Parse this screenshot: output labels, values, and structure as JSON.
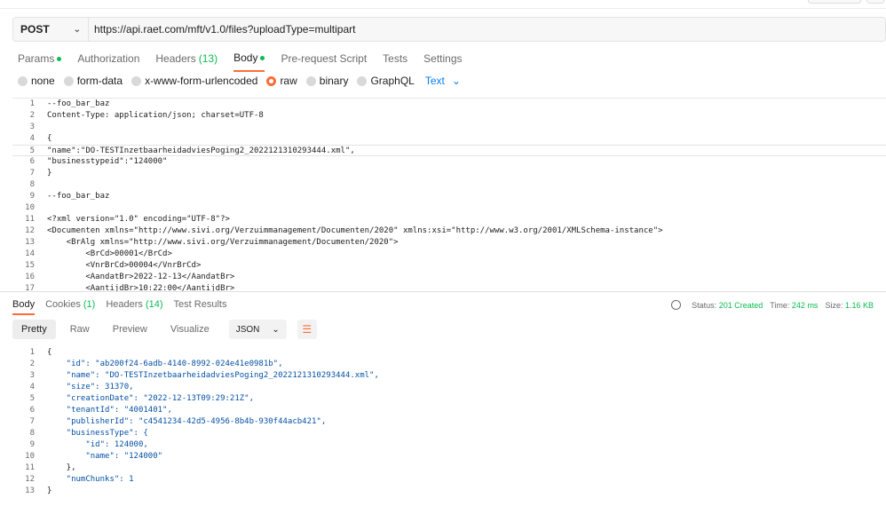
{
  "request": {
    "method": "POST",
    "url": "https://api.raet.com/mft/v1.0/files?uploadType=multipart"
  },
  "tabs": [
    {
      "label": "Params",
      "dot": true
    },
    {
      "label": "Authorization"
    },
    {
      "label": "Headers",
      "count": "(13)"
    },
    {
      "label": "Body",
      "dot": true,
      "active": true
    },
    {
      "label": "Pre-request Script"
    },
    {
      "label": "Tests"
    },
    {
      "label": "Settings"
    }
  ],
  "body_types": [
    {
      "label": "none"
    },
    {
      "label": "form-data"
    },
    {
      "label": "x-www-form-urlencoded"
    },
    {
      "label": "raw",
      "selected": true
    },
    {
      "label": "binary"
    },
    {
      "label": "GraphQL"
    }
  ],
  "raw_format": "Text",
  "request_body": [
    "--foo_bar_baz",
    "Content-Type: application/json; charset=UTF-8",
    "",
    "{",
    "\"name\":\"DO-TESTInzetbaarheidadviesPoging2_2022121310293444.xml\",",
    "\"businesstypeid\":\"124000\"",
    "}",
    "",
    "--foo_bar_baz",
    "",
    "<?xml version=\"1.0\" encoding=\"UTF-8\"?>",
    "<Documenten xmlns=\"http://www.sivi.org/Verzuimmanagement/Documenten/2020\" xmlns:xsi=\"http://www.w3.org/2001/XMLSchema-instance\">",
    "    <BrAlg xmlns=\"http://www.sivi.org/Verzuimmanagement/Documenten/2020\">",
    "        <BrCd>00001</BrCd>",
    "        <VnrBrCd>00004</VnrBrCd>",
    "        <AandatBr>2022-12-13</AandatBr>",
    "        <AantijdBr>10:22:00</AantijdBr>"
  ],
  "response_tabs": [
    {
      "label": "Body",
      "active": true
    },
    {
      "label": "Cookies",
      "count": "(1)"
    },
    {
      "label": "Headers",
      "count": "(14)"
    },
    {
      "label": "Test Results"
    }
  ],
  "status": {
    "status_label": "Status:",
    "status_value": "201 Created",
    "time_label": "Time:",
    "time_value": "242 ms",
    "size_label": "Size:",
    "size_value": "1.16 KB"
  },
  "response_views": [
    "Pretty",
    "Raw",
    "Preview",
    "Visualize"
  ],
  "response_format": "JSON",
  "response_body": [
    "{",
    "    \"id\": \"ab200f24-6adb-4140-8992-024e41e0981b\",",
    "    \"name\": \"DO-TESTInzetbaarheidadviesPoging2_2022121310293444.xml\",",
    "    \"size\": 31370,",
    "    \"creationDate\": \"2022-12-13T09:29:21Z\",",
    "    \"tenantId\": \"4001401\",",
    "    \"publisherId\": \"c4541234-42d5-4956-8b4b-930f44acb421\",",
    "    \"businessType\": {",
    "        \"id\": 124000,",
    "        \"name\": \"124000\"",
    "    },",
    "    \"numChunks\": 1",
    "}"
  ],
  "icons": {
    "method_dropdown": "chevron-down-icon",
    "format_dropdown": "chevron-down-icon",
    "wrap": "wrap-lines-icon",
    "network": "globe-icon"
  },
  "colors": {
    "accent": "#ff6c37",
    "success": "#0cbb52",
    "link": "#097bed"
  }
}
